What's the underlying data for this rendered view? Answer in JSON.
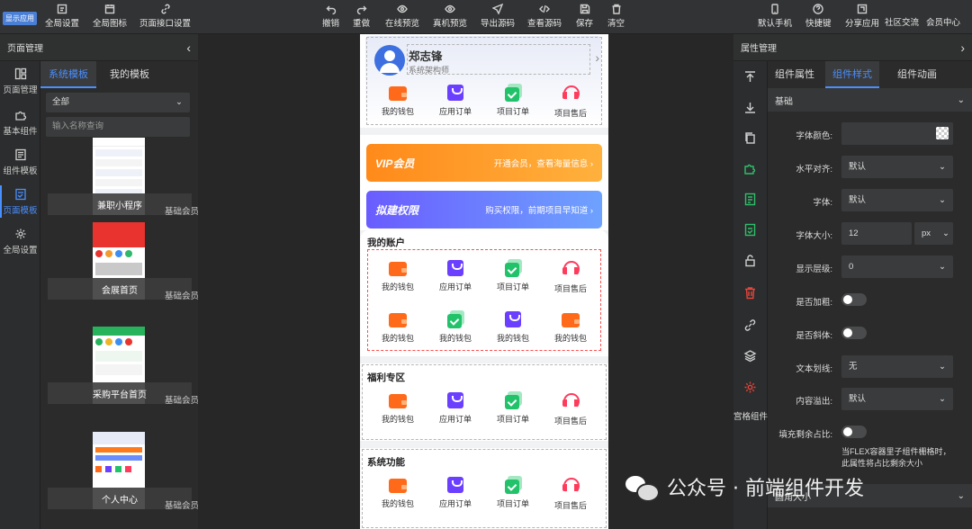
{
  "topbar": {
    "logo_badge": "显示应用",
    "left_buttons": [
      {
        "label": "全局设置",
        "icon": "settings-icon"
      },
      {
        "label": "全局图标",
        "icon": "calendar-icon"
      },
      {
        "label": "页面接口设置",
        "icon": "link-icon"
      }
    ],
    "center_buttons": [
      {
        "label": "撤销",
        "icon": "undo-icon"
      },
      {
        "label": "重做",
        "icon": "redo-icon"
      },
      {
        "label": "在线预览",
        "icon": "eye-icon"
      },
      {
        "label": "真机预览",
        "icon": "eye-icon"
      },
      {
        "label": "导出源码",
        "icon": "send-icon"
      },
      {
        "label": "查看源码",
        "icon": "code-icon"
      },
      {
        "label": "保存",
        "icon": "save-icon"
      },
      {
        "label": "清空",
        "icon": "trash-icon"
      }
    ],
    "right_buttons": [
      {
        "label": "默认手机",
        "icon": "phone-icon"
      },
      {
        "label": "快捷键",
        "icon": "help-icon"
      },
      {
        "label": "分享应用",
        "icon": "share-icon"
      },
      {
        "label": "社区交流",
        "icon": ""
      },
      {
        "label": "会员中心",
        "icon": ""
      }
    ]
  },
  "left_panel": {
    "title": "页面管理",
    "nav": [
      {
        "label": "页面管理",
        "icon": "layout-icon"
      },
      {
        "label": "基本组件",
        "icon": "puzzle-icon"
      },
      {
        "label": "组件模板",
        "icon": "template-icon"
      },
      {
        "label": "页面模板",
        "icon": "page-template-icon",
        "active": true
      },
      {
        "label": "全局设置",
        "icon": "gear-icon"
      }
    ],
    "tabs": [
      "系统模板",
      "我的模板"
    ],
    "filter_value": "全部",
    "search_placeholder": "输入名称查询",
    "templates": [
      {
        "name": "兼职小程序",
        "tag": "基础会员"
      },
      {
        "name": "会展首页",
        "tag": "基础会员"
      },
      {
        "name": "采购平台首页",
        "tag": "基础会员"
      },
      {
        "name": "个人中心",
        "tag": "基础会员"
      }
    ]
  },
  "phone": {
    "profile": {
      "name": "郑志锋",
      "role": "系统架构师"
    },
    "top_grid": [
      "我的钱包",
      "应用订单",
      "项目订单",
      "项目售后"
    ],
    "vip_banner": {
      "title": "VIP会员",
      "subtitle": "开通会员，查看海量信息 ›"
    },
    "rights_banner": {
      "title": "拟建权限",
      "subtitle": "购买权限，前期项目早知道 ›"
    },
    "account_section": {
      "title": "我的账户",
      "row1": [
        "我的钱包",
        "应用订单",
        "项目订单",
        "项目售后"
      ],
      "row2": [
        "我的钱包",
        "我的钱包",
        "我的钱包",
        "我的钱包"
      ]
    },
    "welfare_section": {
      "title": "福利专区",
      "items": [
        "我的钱包",
        "应用订单",
        "项目订单",
        "项目售后"
      ]
    },
    "system_section": {
      "title": "系统功能",
      "items": [
        "我的钱包",
        "应用订单",
        "项目订单",
        "项目售后"
      ]
    }
  },
  "right_panel": {
    "title": "属性管理",
    "side_label": "宫格组件",
    "tabs": [
      "组件属性",
      "组件样式",
      "组件动画"
    ],
    "group": "基础",
    "props": {
      "font_color_label": "字体颜色:",
      "align_label": "水平对齐:",
      "align_value": "默认",
      "font_label": "字体:",
      "font_value": "默认",
      "size_label": "字体大小:",
      "size_value": "12",
      "size_unit": "px",
      "z_label": "显示层级:",
      "z_value": "0",
      "bold_label": "是否加粗:",
      "italic_label": "是否斜体:",
      "decoration_label": "文本划线:",
      "decoration_value": "无",
      "overflow_label": "内容溢出:",
      "overflow_value": "默认",
      "flex_label": "填充剩余占比:",
      "flex_hint": "当FLEX容器里子组件栅格时，此属性将占比剩余大小",
      "bottom_label": "圆角大小"
    }
  },
  "watermark": "公众号 · 前端组件开发"
}
